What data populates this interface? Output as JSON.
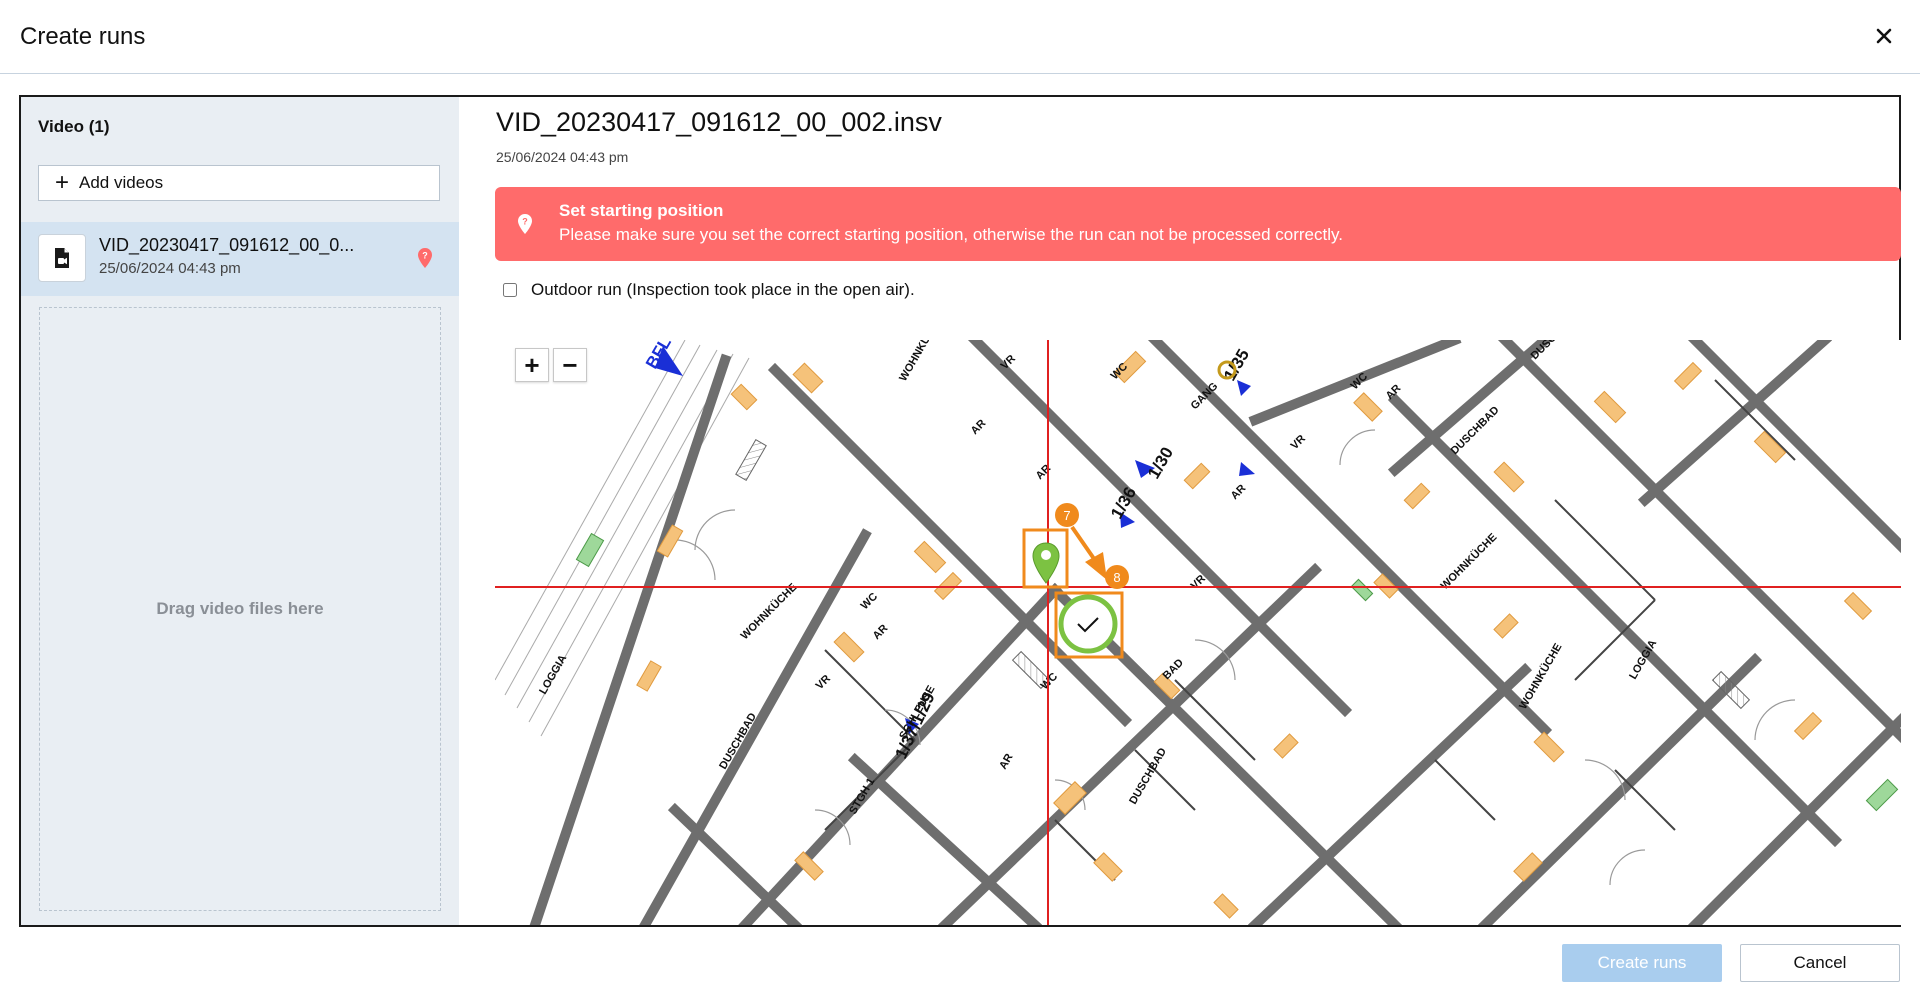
{
  "dialog": {
    "title": "Create runs",
    "close_icon": "close-icon"
  },
  "sidebar": {
    "title": "Video (1)",
    "add_videos_label": "Add videos",
    "videos": [
      {
        "name": "VID_20230417_091612_00_0...",
        "date": "25/06/2024 04:43 pm",
        "status_icon": "map-pin-warning-icon"
      }
    ],
    "dropzone_text": "Drag video files here"
  },
  "main": {
    "file_title": "VID_20230417_091612_00_002.insv",
    "file_date": "25/06/2024 04:43 pm",
    "banner": {
      "title": "Set starting position",
      "text": "Please make sure you set the correct starting position, otherwise the run can not be processed correctly.",
      "icon": "map-pin-icon",
      "color": "#ff6b6b"
    },
    "outdoor_label": "Outdoor run (Inspection took place in the open air).",
    "outdoor_checked": false,
    "map": {
      "zoom_in": "+",
      "zoom_out": "−",
      "step_badges": [
        "7",
        "8"
      ],
      "labels": [
        "WOHNKÜCHE",
        "WC",
        "AR",
        "VR",
        "GANG",
        "DUSCHBAD",
        "BAD",
        "SCHLEUSE",
        "LOGGIA",
        "STGH 1",
        "1/35",
        "1/30",
        "1/36",
        "1/37/1/29",
        "BFL"
      ],
      "crosshair_color": "#e02020",
      "highlight_color": "#f08a1c",
      "pin_color": "#7cc242"
    }
  },
  "footer": {
    "create_label": "Create runs",
    "cancel_label": "Cancel"
  }
}
